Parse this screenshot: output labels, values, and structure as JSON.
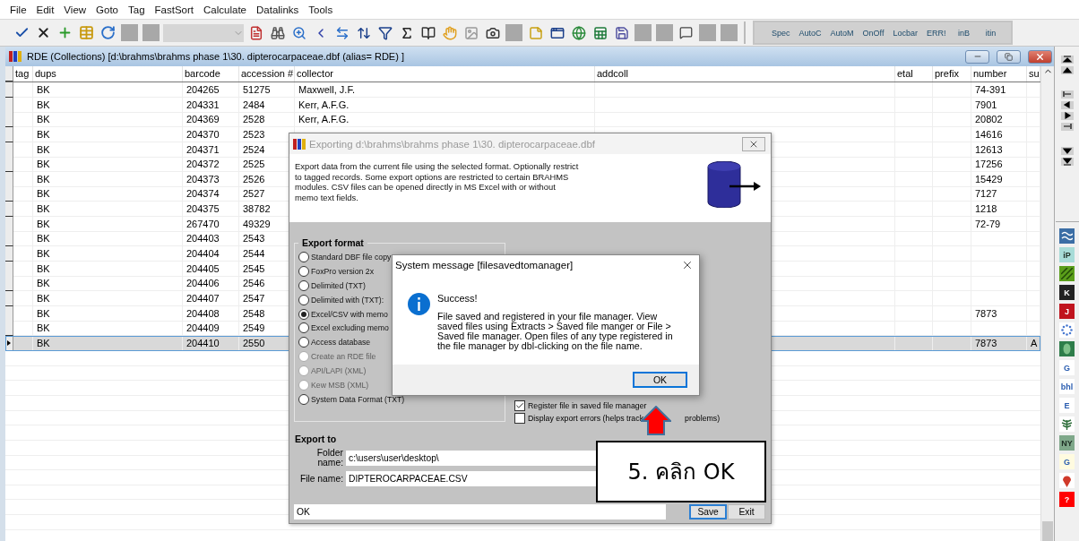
{
  "menu": [
    "File",
    "Edit",
    "View",
    "Goto",
    "Tag",
    "FastSort",
    "Calculate",
    "Datalinks",
    "Tools"
  ],
  "toolbar_text_buttons": [
    "Spec",
    "AutoC",
    "AutoM",
    "OnOff",
    "Locbar",
    "ERR!",
    "inB",
    "itin"
  ],
  "window": {
    "title": "RDE (Collections) [d:\\brahms\\brahms phase 1\\30. dipterocarpaceae.dbf (alias= RDE) ]"
  },
  "table": {
    "columns": [
      "tag",
      "dups",
      "barcode",
      "accession #",
      "collector",
      "addcoll",
      "etal",
      "prefix",
      "number",
      "su"
    ],
    "rows": [
      {
        "selected": false,
        "cells": [
          null,
          "BK",
          "204265",
          "51275",
          "Maxwell, J.F.",
          null,
          null,
          null,
          "74-391",
          null
        ]
      },
      {
        "selected": false,
        "cells": [
          null,
          "BK",
          "204331",
          "2484",
          "Kerr, A.F.G.",
          null,
          null,
          null,
          "7901",
          null
        ]
      },
      {
        "selected": false,
        "cells": [
          null,
          "BK",
          "204369",
          "2528",
          "Kerr, A.F.G.",
          null,
          null,
          null,
          "20802",
          null
        ]
      },
      {
        "selected": false,
        "cells": [
          null,
          "BK",
          "204370",
          "2523",
          null,
          null,
          null,
          null,
          "14616",
          null
        ]
      },
      {
        "selected": false,
        "cells": [
          null,
          "BK",
          "204371",
          "2524",
          null,
          null,
          null,
          null,
          "12613",
          null
        ]
      },
      {
        "selected": false,
        "cells": [
          null,
          "BK",
          "204372",
          "2525",
          null,
          null,
          null,
          null,
          "17256",
          null
        ]
      },
      {
        "selected": false,
        "cells": [
          null,
          "BK",
          "204373",
          "2526",
          null,
          null,
          null,
          null,
          "15429",
          null
        ]
      },
      {
        "selected": false,
        "cells": [
          null,
          "BK",
          "204374",
          "2527",
          null,
          null,
          null,
          null,
          "7127",
          null
        ]
      },
      {
        "selected": false,
        "cells": [
          null,
          "BK",
          "204375",
          "38782",
          null,
          null,
          null,
          null,
          "1218",
          null
        ]
      },
      {
        "selected": false,
        "cells": [
          null,
          "BK",
          "267470",
          "49329",
          null,
          null,
          null,
          null,
          "72-79",
          null
        ]
      },
      {
        "selected": false,
        "cells": [
          null,
          "BK",
          "204403",
          "2543",
          null,
          null,
          null,
          null,
          null,
          null
        ]
      },
      {
        "selected": false,
        "cells": [
          null,
          "BK",
          "204404",
          "2544",
          null,
          null,
          null,
          null,
          null,
          null
        ]
      },
      {
        "selected": false,
        "cells": [
          null,
          "BK",
          "204405",
          "2545",
          null,
          null,
          null,
          null,
          null,
          null
        ]
      },
      {
        "selected": false,
        "cells": [
          null,
          "BK",
          "204406",
          "2546",
          null,
          null,
          null,
          null,
          null,
          null
        ]
      },
      {
        "selected": false,
        "cells": [
          null,
          "BK",
          "204407",
          "2547",
          null,
          null,
          null,
          null,
          null,
          null
        ]
      },
      {
        "selected": false,
        "cells": [
          null,
          "BK",
          "204408",
          "2548",
          null,
          null,
          null,
          null,
          "7873",
          null
        ]
      },
      {
        "selected": false,
        "cells": [
          null,
          "BK",
          "204409",
          "2549",
          null,
          null,
          null,
          null,
          null,
          null
        ]
      },
      {
        "selected": true,
        "cells": [
          null,
          "BK",
          "204410",
          "2550",
          null,
          null,
          null,
          null,
          "7873",
          "A"
        ]
      }
    ]
  },
  "export_dialog": {
    "title": "Exporting d:\\brahms\\brahms phase 1\\30. dipterocarpaceae.dbf",
    "description": "Export data from the current file using the selected format. Optionally restrict to tagged records. Some export options are restricted to certain BRAHMS modules. CSV files can be opened directly in MS Excel with or without memo text fields.",
    "format_group": {
      "title": "Export format",
      "options": [
        {
          "label": "Standard DBF file copy",
          "selected": false,
          "disabled": false
        },
        {
          "label": "FoxPro version 2x",
          "selected": false,
          "disabled": false
        },
        {
          "label": "Delimited (TXT)",
          "selected": false,
          "disabled": false
        },
        {
          "label": "Delimited with (TXT):",
          "selected": false,
          "disabled": false
        },
        {
          "label": "Excel/CSV with memo",
          "selected": true,
          "disabled": false
        },
        {
          "label": "Excel excluding memo",
          "selected": false,
          "disabled": false
        },
        {
          "label": "Access database",
          "selected": false,
          "disabled": false
        },
        {
          "label": "Create an RDE file",
          "selected": false,
          "disabled": true
        },
        {
          "label": "API/LAPI (XML)",
          "selected": false,
          "disabled": true
        },
        {
          "label": "Kew MSB (XML)",
          "selected": false,
          "disabled": true
        },
        {
          "label": "System Data Format (TXT)",
          "selected": false,
          "disabled": false
        }
      ]
    },
    "options": [
      {
        "label": "Register file in saved file manager",
        "checked": true
      },
      {
        "label": "Display export errors (helps track",
        "label_end": "problems)",
        "checked": false
      }
    ],
    "export_to": {
      "title": "Export to",
      "folder_label": "Folder name:",
      "folder": "c:\\users\\user\\desktop\\",
      "file_label": "File name:",
      "file": "DIPTEROCARPACEAE.CSV"
    },
    "status": "OK",
    "buttons": [
      "Save",
      "Exit"
    ]
  },
  "message_box": {
    "title": "System message [filesavedtomanager]",
    "heading": "Success!",
    "body": "File saved and registered in your file manager.  View saved files using Extracts > Saved file manger  or  File > Saved file manager. Open files of any type registered in the file manager by dbl-clicking on the file name.",
    "button": "OK"
  },
  "callout": {
    "text": "5. คลิก OK"
  },
  "side_tools": [
    {
      "kind": "wave",
      "color": "#3b6ea5"
    },
    {
      "kind": "glyph",
      "label": "iP",
      "color": "#a8dcd8"
    },
    {
      "kind": "stripes",
      "color": "#5a9e1a"
    },
    {
      "kind": "glyph",
      "label": "K",
      "color": "#222222"
    },
    {
      "kind": "glyph",
      "label": "J",
      "color": "#c0141e"
    },
    {
      "kind": "dots",
      "color": "#ffffff"
    },
    {
      "kind": "leaf",
      "color": "#2e7d4a"
    },
    {
      "kind": "glyph",
      "label": "G",
      "color": "#ffffff"
    },
    {
      "kind": "glyph",
      "label": "bhl",
      "color": "#ffffff"
    },
    {
      "kind": "glyph",
      "label": "E",
      "color": "#ffffff"
    },
    {
      "kind": "fern",
      "color": "#ffffff"
    },
    {
      "kind": "glyph",
      "label": "NY",
      "color": "#7fa88a"
    },
    {
      "kind": "glyph",
      "label": "G",
      "color": "#fffbe0"
    },
    {
      "kind": "pin",
      "color": "#ffffff"
    },
    {
      "kind": "glyph",
      "label": "?",
      "color": "#ff0000"
    }
  ]
}
